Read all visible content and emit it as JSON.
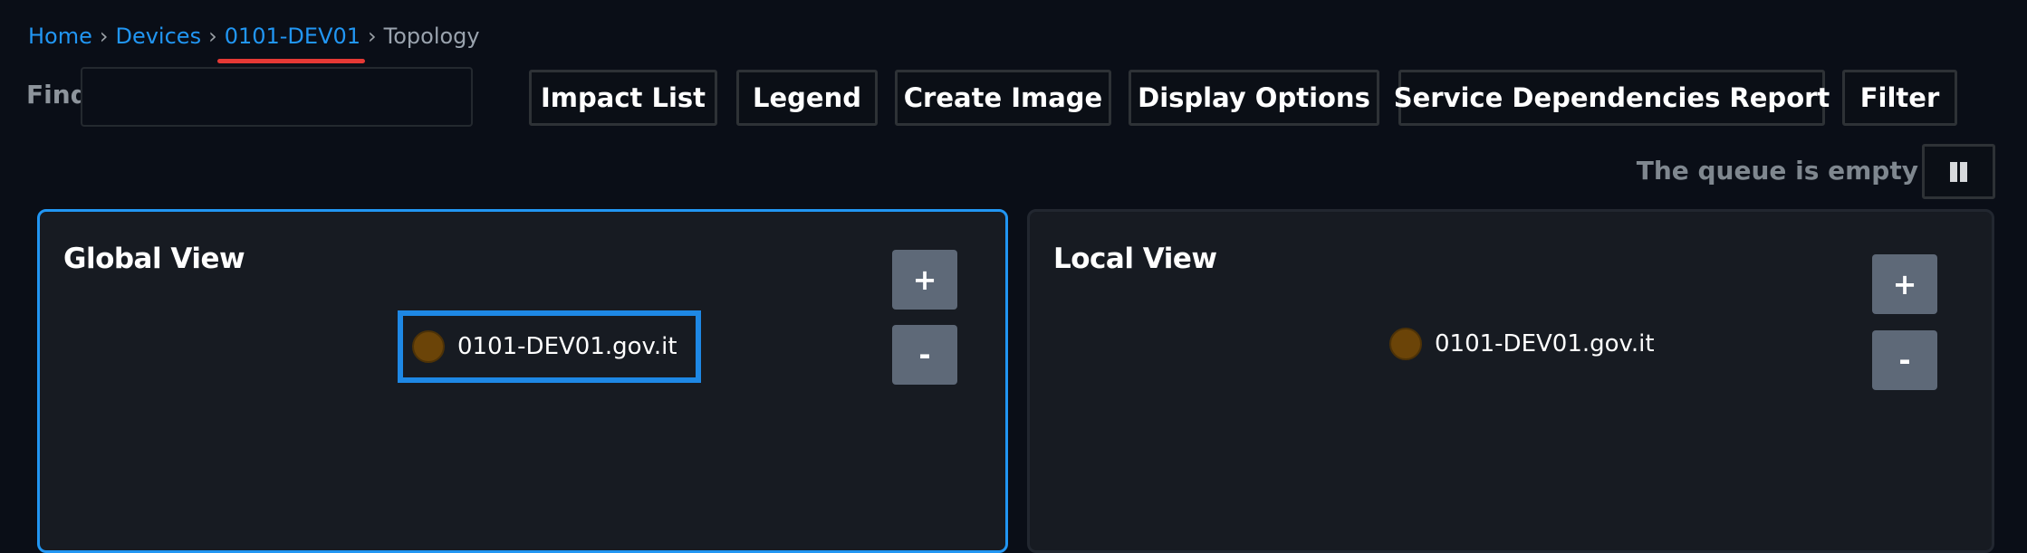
{
  "breadcrumb": {
    "home": "Home",
    "devices": "Devices",
    "device": "0101-DEV01",
    "current": "Topology",
    "separator": "›"
  },
  "find": {
    "label": "Find",
    "value": "",
    "placeholder": ""
  },
  "toolbar": {
    "impact_list": "Impact List",
    "legend": "Legend",
    "create_image": "Create Image",
    "display_options": "Display Options",
    "service_dependencies_report": "Service Dependencies Report",
    "filter": "Filter"
  },
  "queue": {
    "status": "The queue is empty",
    "pause_icon": "pause-icon"
  },
  "global_view": {
    "title": "Global View",
    "zoom_in": "+",
    "zoom_out": "-",
    "node_label": "0101-DEV01.gov.it",
    "node_selected": true
  },
  "local_view": {
    "title": "Local View",
    "zoom_in": "+",
    "zoom_out": "-",
    "node_label": "0101-DEV01.gov.it"
  },
  "colors": {
    "accent": "#2196f3",
    "background": "#0a0e17",
    "panel": "#171b22",
    "node_status": "#6b4408",
    "active_underline": "#e53935"
  }
}
